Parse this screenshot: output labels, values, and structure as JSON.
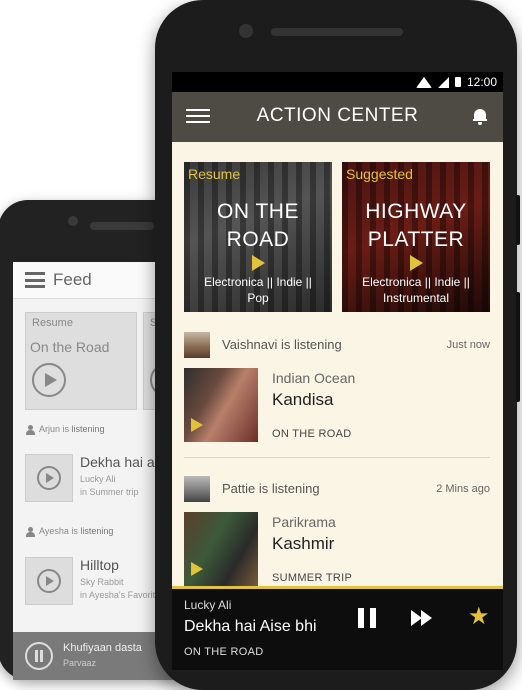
{
  "back_phone": {
    "header": {
      "title": "Feed"
    },
    "card": {
      "label": "Resume",
      "title": "On the Road",
      "second_label": "S"
    },
    "items": [
      {
        "user": "Arjun is",
        "action": "listening",
        "song": "Dekha hai a",
        "artist": "Lucky Ali",
        "playlist": "in Summer trip"
      },
      {
        "user": "Ayesha is",
        "action": "listening",
        "song": "Hilltop",
        "artist": "Sky Rabbit",
        "playlist": "in Ayesha's Favorite"
      }
    ],
    "player": {
      "song": "Khufiyaan dasta",
      "artist": "Parvaaz"
    }
  },
  "front_phone": {
    "status_bar": {
      "time": "12:00"
    },
    "app_bar": {
      "title": "ACTION CENTER"
    },
    "cards": [
      {
        "tag": "Resume",
        "title_line1": "ON THE",
        "title_line2": "ROAD",
        "genre_line1": "Electronica || Indie ||",
        "genre_line2": "Pop"
      },
      {
        "tag": "Suggested",
        "title_line1": "HIGHWAY",
        "title_line2": "PLATTER",
        "genre_line1": "Electronica || Indie ||",
        "genre_line2": "Instrumental"
      }
    ],
    "feed": [
      {
        "who": "Vaishnavi is listening",
        "when": "Just now",
        "artist": "Indian Ocean",
        "song": "Kandisa",
        "playlist": "ON THE ROAD"
      },
      {
        "who": "Pattie is listening",
        "when": "2 Mins ago",
        "artist": "Parikrama",
        "song": "Kashmir",
        "playlist": "SUMMER TRIP"
      }
    ],
    "player": {
      "artist": "Lucky Ali",
      "song": "Dekha hai Aise bhi",
      "playlist": "ON THE ROAD"
    }
  },
  "colors": {
    "accent": "#e2c23a",
    "app_bar": "#4e4a44",
    "screen_bg": "#faf5e4"
  },
  "icons": [
    "menu-icon",
    "bell-icon",
    "wifi-icon",
    "signal-icon",
    "battery-icon",
    "play-icon",
    "pause-icon",
    "fast-forward-icon",
    "star-icon"
  ]
}
